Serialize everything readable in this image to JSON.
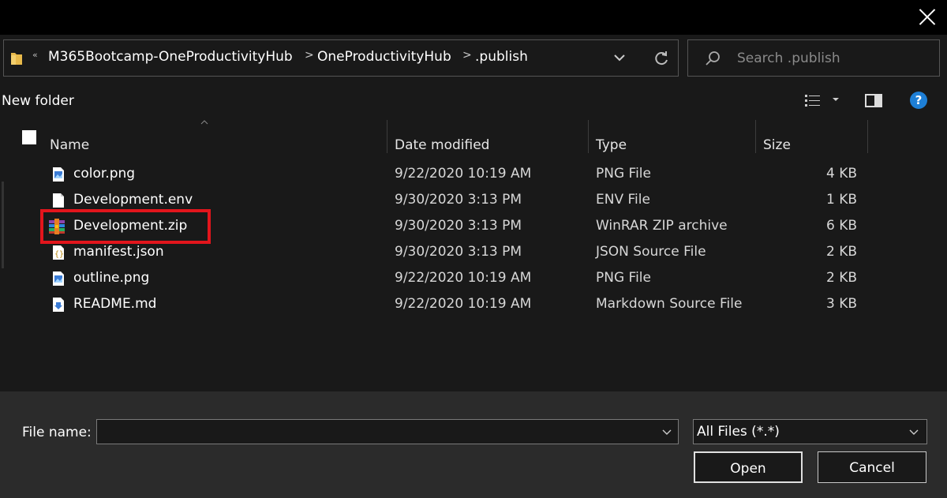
{
  "window": {
    "close_label": ""
  },
  "address": {
    "overflow": "«",
    "crumbs": [
      "M365Bootcamp-OneProductivityHub",
      "OneProductivityHub",
      ".publish"
    ],
    "separator": ">"
  },
  "search": {
    "placeholder": "Search .publish"
  },
  "toolbar": {
    "new_folder": "New folder",
    "help": "?"
  },
  "columns": {
    "name": "Name",
    "date": "Date modified",
    "type": "Type",
    "size": "Size"
  },
  "files": [
    {
      "name": "color.png",
      "date": "9/22/2020 10:19 AM",
      "type": "PNG File",
      "size": "4 KB",
      "icon": "image-file-icon"
    },
    {
      "name": "Development.env",
      "date": "9/30/2020 3:13 PM",
      "type": "ENV File",
      "size": "1 KB",
      "icon": "blank-file-icon"
    },
    {
      "name": "Development.zip",
      "date": "9/30/2020 3:13 PM",
      "type": "WinRAR ZIP archive",
      "size": "6 KB",
      "icon": "winrar-archive-icon",
      "highlighted": true
    },
    {
      "name": "manifest.json",
      "date": "9/30/2020 3:13 PM",
      "type": "JSON Source File",
      "size": "2 KB",
      "icon": "json-file-icon"
    },
    {
      "name": "outline.png",
      "date": "9/22/2020 10:19 AM",
      "type": "PNG File",
      "size": "2 KB",
      "icon": "image-file-icon"
    },
    {
      "name": "README.md",
      "date": "9/22/2020 10:19 AM",
      "type": "Markdown Source File",
      "size": "3 KB",
      "icon": "markdown-file-icon"
    }
  ],
  "footer": {
    "file_name_label": "File name:",
    "file_name_value": "",
    "file_type": "All Files (*.*)",
    "open": "Open",
    "cancel": "Cancel"
  },
  "colors": {
    "highlight": "#e2151c",
    "accent": "#1e7fd6",
    "background": "#191919"
  }
}
